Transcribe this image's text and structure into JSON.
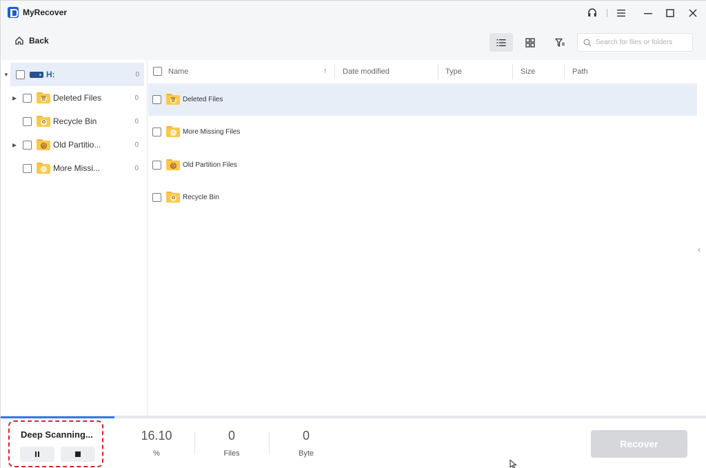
{
  "app": {
    "title": "MyRecover"
  },
  "titlebar": {
    "icons": [
      "headset-icon",
      "menu-icon",
      "minimize-icon",
      "maximize-icon",
      "close-icon"
    ]
  },
  "toolbar": {
    "back_label": "Back",
    "views": [
      "list-view-icon",
      "grid-view-icon",
      "filter-icon"
    ],
    "search_placeholder": "Search for files or folders"
  },
  "tree": {
    "root": {
      "label": "H:",
      "count": "0"
    },
    "items": [
      {
        "label": "Deleted Files",
        "count": "0",
        "expandable": true,
        "icon": "trash"
      },
      {
        "label": "Recycle Bin",
        "count": "0",
        "expandable": false,
        "icon": "recycle"
      },
      {
        "label": "Old Partitio...",
        "count": "0",
        "expandable": true,
        "icon": "clock"
      },
      {
        "label": "More Missi...",
        "count": "0",
        "expandable": false,
        "icon": "dots"
      }
    ]
  },
  "list": {
    "columns": [
      "Name",
      "Date modified",
      "Type",
      "Size",
      "Path"
    ],
    "files": [
      {
        "name": "Deleted Files",
        "icon": "trash"
      },
      {
        "name": "More Missing Files",
        "icon": "dots"
      },
      {
        "name": "Old Partition Files",
        "icon": "clock"
      },
      {
        "name": "Recycle Bin",
        "icon": "recycle"
      }
    ]
  },
  "scan": {
    "status": "Deep Scanning...",
    "progress_fraction": 0.161,
    "percent_value": "16.10",
    "percent_label": "%",
    "files_value": "0",
    "files_label": "Files",
    "bytes_value": "0",
    "bytes_label": "Byte"
  },
  "recover_label": "Recover"
}
